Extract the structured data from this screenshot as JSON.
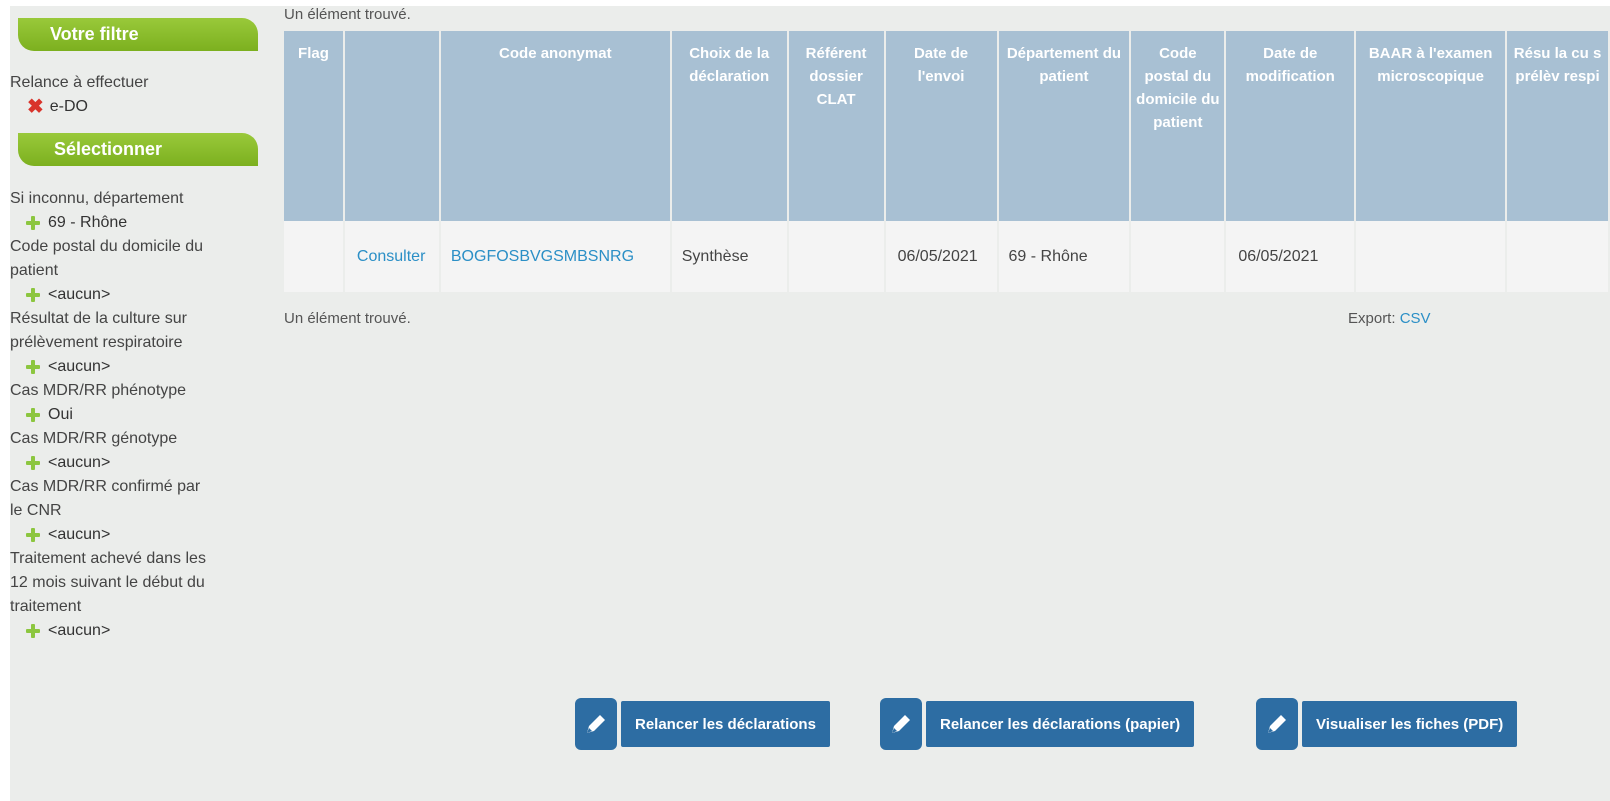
{
  "sidebar": {
    "filter_title": "Votre filtre",
    "relance_label": "Relance à effectuer",
    "relance_value": "e-DO",
    "select_title": "Sélectionner",
    "criteria": [
      {
        "label_lines": [
          "Si inconnu, département"
        ],
        "value": "69 - Rhône"
      },
      {
        "label_lines": [
          "Code postal du domicile du",
          "patient"
        ],
        "value": "<aucun>"
      },
      {
        "label_lines": [
          "Résultat de la culture sur",
          "prélèvement respiratoire"
        ],
        "value": "<aucun>"
      },
      {
        "label_lines": [
          "Cas MDR/RR phénotype"
        ],
        "value": "Oui"
      },
      {
        "label_lines": [
          "Cas MDR/RR génotype"
        ],
        "value": "<aucun>"
      },
      {
        "label_lines": [
          "Cas MDR/RR confirmé par",
          "le CNR"
        ],
        "value": "<aucun>"
      },
      {
        "label_lines": [
          "Traitement achevé dans les",
          "12 mois suivant le début du",
          "traitement"
        ],
        "value": "<aucun>"
      }
    ]
  },
  "results": {
    "count_text_top": "Un élément trouvé.",
    "count_text_bottom": "Un élément trouvé.",
    "export_label": "Export:",
    "export_link": "CSV",
    "headers": [
      "Flag",
      "",
      "Code anonymat",
      "Choix de la déclaration",
      "Référent dossier CLAT",
      "Date de l'envoi",
      "Département du patient",
      "Code postal du domicile du patient",
      "Date de modification",
      "BAAR à l'examen microscopique",
      "Résu la cu s prélèv respi"
    ],
    "rows": [
      [
        "",
        "Consulter",
        "BOGFOSBVGSMBSNRG",
        "Synthèse",
        "",
        "06/05/2021",
        "69 - Rhône",
        "",
        "06/05/2021",
        "",
        ""
      ]
    ]
  },
  "buttons": [
    {
      "label": "Relancer les déclarations",
      "icon": "pencil-icon"
    },
    {
      "label": "Relancer les déclarations (papier)",
      "icon": "pencil-icon"
    },
    {
      "label": "Visualiser les fiches (PDF)",
      "icon": "pencil-icon"
    }
  ],
  "colors": {
    "accent_green": "#8cc63f",
    "header_blue": "#a8c0d3",
    "button_blue": "#2d6da3",
    "link_blue": "#2b8fc6"
  }
}
